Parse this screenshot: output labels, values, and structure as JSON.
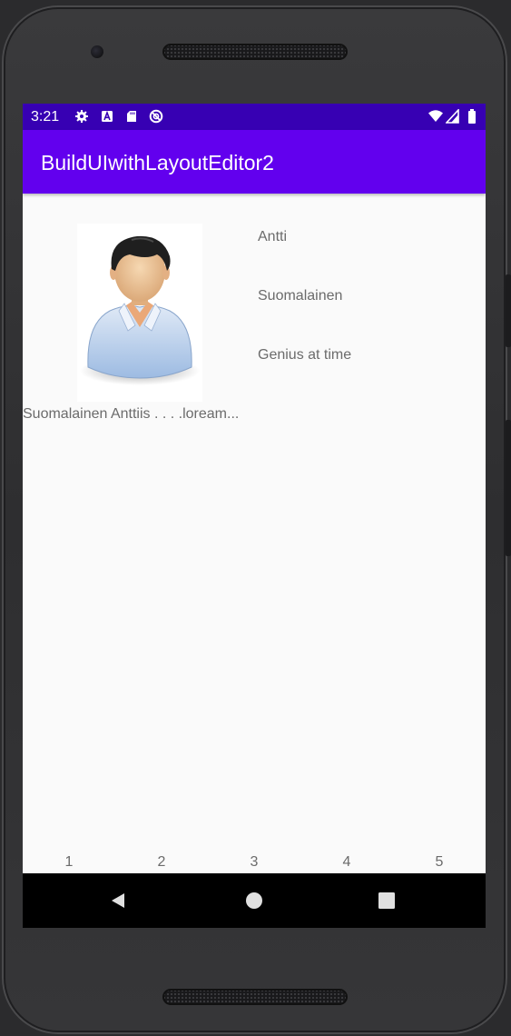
{
  "status_bar": {
    "time": "3:21",
    "icons": [
      "settings-gear-icon",
      "a-box-icon",
      "sd-card-icon",
      "do-not-disturb-icon",
      "wifi-icon",
      "signal-icon",
      "battery-icon"
    ]
  },
  "app_bar": {
    "title": "BuildUIwithLayoutEditor2"
  },
  "profile": {
    "avatar": "person-avatar-icon",
    "name": "Antti",
    "nationality": "Suomalainen",
    "role": "Genius at time",
    "description": "Suomalainen Anttiis . . . .loream..."
  },
  "pagination": [
    "1",
    "2",
    "3",
    "4",
    "5"
  ],
  "navigation": {
    "buttons": [
      "back-triangle-icon",
      "home-circle-icon",
      "recents-square-icon"
    ]
  },
  "colors": {
    "status_bar": "#3700b3",
    "app_bar": "#6200ee",
    "background": "#fafafa",
    "text": "#6b6b6b",
    "nav_bar": "#000000"
  }
}
